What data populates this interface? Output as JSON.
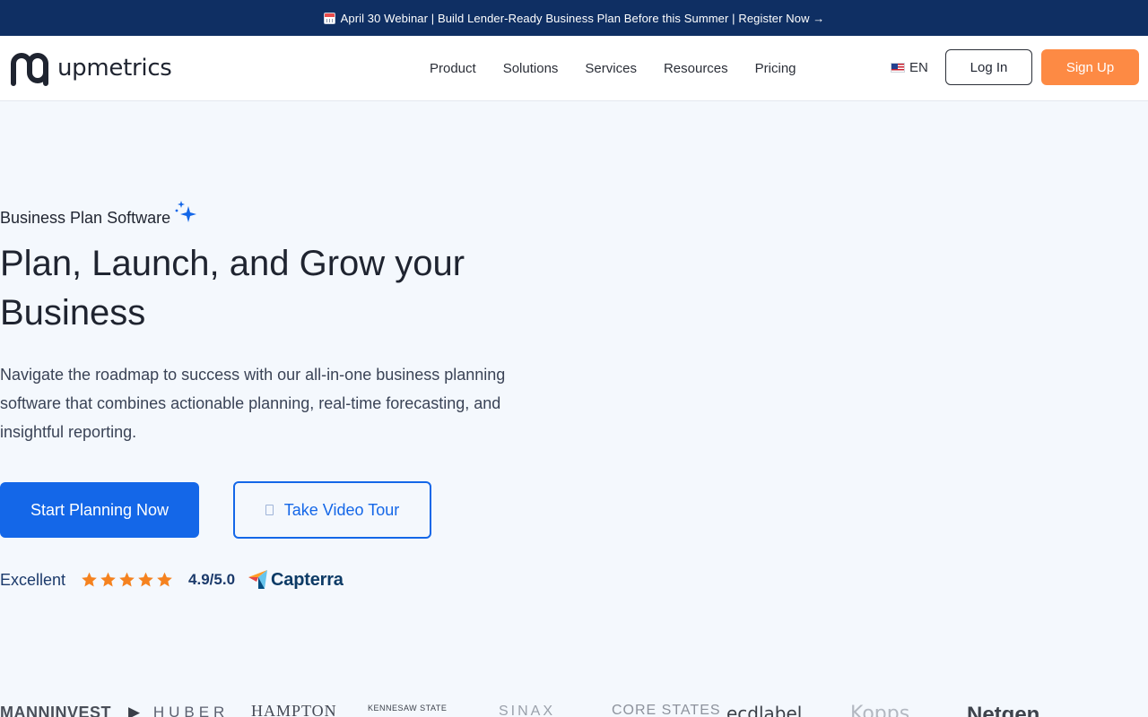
{
  "announcement": {
    "icon": "calendar-icon",
    "text": "April 30 Webinar | Build Lender-Ready Business Plan Before this Summer | Register Now →"
  },
  "header": {
    "brand": "upmetrics",
    "nav": [
      "Product",
      "Solutions",
      "Services",
      "Resources",
      "Pricing"
    ],
    "language": "EN",
    "login_label": "Log In",
    "signup_label": "Sign Up"
  },
  "hero": {
    "eyebrow": "Business Plan Software",
    "title": "Plan, Launch, and Grow your Business",
    "description": "Navigate the roadmap to success with our all-in-one business planning software that combines actionable planning, real-time forecasting, and insightful reporting.",
    "primary_cta": "Start Planning Now",
    "secondary_cta": "Take Video Tour"
  },
  "rating": {
    "label": "Excellent",
    "stars": 5,
    "score": "4.9/5.0",
    "platform": "Capterra"
  },
  "client_logos": [
    "MANNINVEST",
    "HUBER",
    "HAMPTON",
    "KENNESAW STATE",
    "SINAX",
    "CORE STATES",
    "ecdlabel",
    "Kopps",
    "Netgen"
  ],
  "colors": {
    "announcement_bg": "#0f2f63",
    "primary": "#1467e8",
    "signup": "#fd8a44",
    "page_bg": "#f4f8fd",
    "star": "#f5821f"
  }
}
